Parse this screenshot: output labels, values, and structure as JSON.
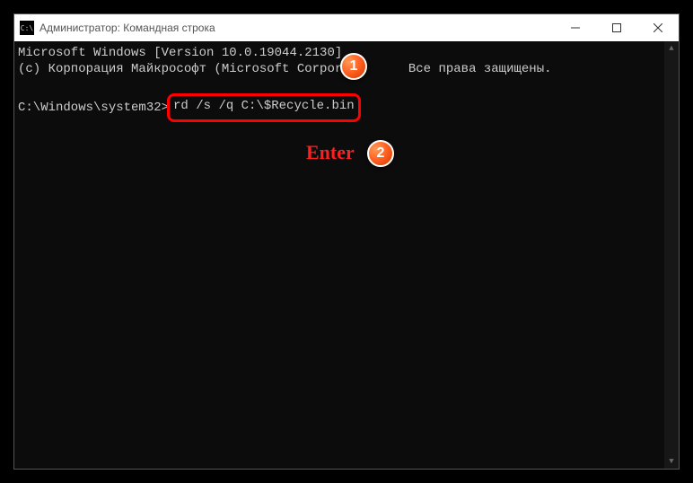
{
  "titlebar": {
    "icon_text": "C:\\",
    "title": "Администратор: Командная строка"
  },
  "terminal": {
    "line1": "Microsoft Windows [Version 10.0.19044.2130]",
    "line2_a": "(c) Корпорация Майкрософт (Microsoft Corporati",
    "line2_b": " Все права защищены.",
    "prompt": "C:\\Windows\\system32>",
    "command": "rd /s /q C:\\$Recycle.bin"
  },
  "annotations": {
    "badge1": "1",
    "badge2": "2",
    "enter_label": "Enter"
  }
}
